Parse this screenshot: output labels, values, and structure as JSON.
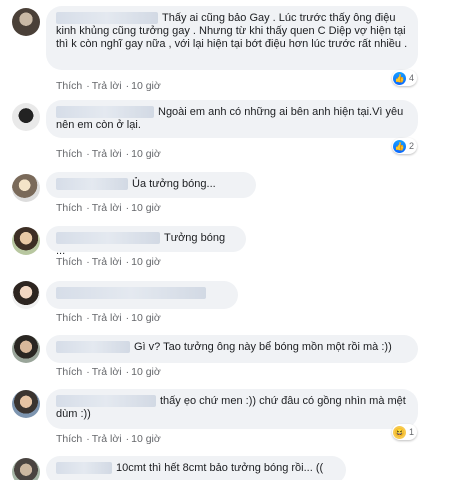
{
  "actions": {
    "like": "Thích",
    "reply": "Trả lời",
    "sep": "·",
    "time": "10 giờ"
  },
  "comments": [
    {
      "text": "Thấy ai cũng bảo Gay . Lúc trước thấy ông điệu kinh khủng cũng tưởng gay . Nhưng từ khi thấy quen C Diệp vợ hiện tại thì k còn nghĩ gay nữa , với lại hiện tại bớt điệu hơn lúc trước rất nhiều .",
      "reactions": "4"
    },
    {
      "text": "Ngoài em anh có những ai bên anh hiện tại.Vì yêu nên em còn ở lại.",
      "reactions": "2"
    },
    {
      "text": "Ủa tưởng bóng..."
    },
    {
      "text": "Tưởng bóng ..."
    },
    {
      "text": ""
    },
    {
      "text": "Gì v? Tao tưởng ông này bể bóng mồn một rồi mà :))"
    },
    {
      "text": "thấy ẹo chứ men :)) chứ đâu có gồng nhìn mà mệt dùm :))",
      "reactions": "1"
    },
    {
      "text": "10cmt thì hết 8cmt bảo tưởng bóng rồi... (("
    }
  ]
}
